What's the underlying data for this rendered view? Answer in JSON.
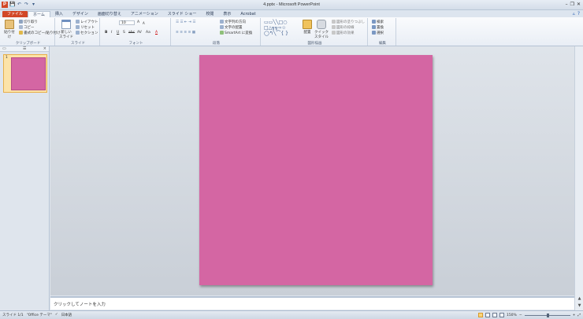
{
  "window": {
    "title": "4.pptx - Microsoft PowerPoint",
    "logo_letter": "P",
    "qat": {
      "save": "💾",
      "undo": "↶",
      "redo": "↷",
      "more": "▾"
    },
    "controls": [
      "–",
      "❐",
      "✕"
    ]
  },
  "tabs": [
    "ファイル",
    "ホーム",
    "挿入",
    "デザイン",
    "画面切り替え",
    "アニメーション",
    "スライド ショー",
    "校閲",
    "表示",
    "Acrobat"
  ],
  "active_tab": "ホーム",
  "help_icons": [
    "▵",
    "?"
  ],
  "ribbon": {
    "clipboard": {
      "paste": "貼り付け",
      "cut": "切り取り",
      "copy": "コピー",
      "format_painter": "書式のコピー/貼り付け",
      "label": "クリップボード"
    },
    "slides": {
      "new_slide": "新しい",
      "new_slide2": "スライド",
      "layout": "レイアウト",
      "reset": "リセット",
      "section": "セクション",
      "label": "スライド"
    },
    "font": {
      "size_value": "10",
      "grow": "A",
      "shrink": "A",
      "bold": "B",
      "italic": "I",
      "underline": "U",
      "shadow": "S",
      "strike": "abc",
      "spacing": "AV",
      "case": "Aa",
      "color": "A",
      "label": "フォント"
    },
    "paragraph": {
      "text_direction": "文字列の方向",
      "align_text": "文字の配置",
      "smartart": "SmartArt に変換",
      "label": "段落"
    },
    "drawing": {
      "arrange": "配置",
      "quick_styles": "クイック",
      "quick_styles2": "スタイル",
      "shape_fill": "図形の塗りつぶし",
      "shape_outline": "図形の枠線",
      "shape_effects": "図形の効果",
      "label": "図形描画"
    },
    "editing": {
      "find": "検索",
      "replace": "置換",
      "select": "選択",
      "label": "編集"
    }
  },
  "thumbnail_pane": {
    "close_icon": "×",
    "slide_number": "1"
  },
  "slide": {
    "background_color": "#d466a3"
  },
  "notes_placeholder": "クリックしてノートを入力",
  "status": {
    "slide_info": "スライド 1/1",
    "theme": "\"Office テーマ\"",
    "language": "日本語",
    "zoom": "150%",
    "zoom_minus": "−",
    "zoom_plus": "+"
  },
  "scroll": {
    "up": "▲",
    "down": "▼"
  }
}
